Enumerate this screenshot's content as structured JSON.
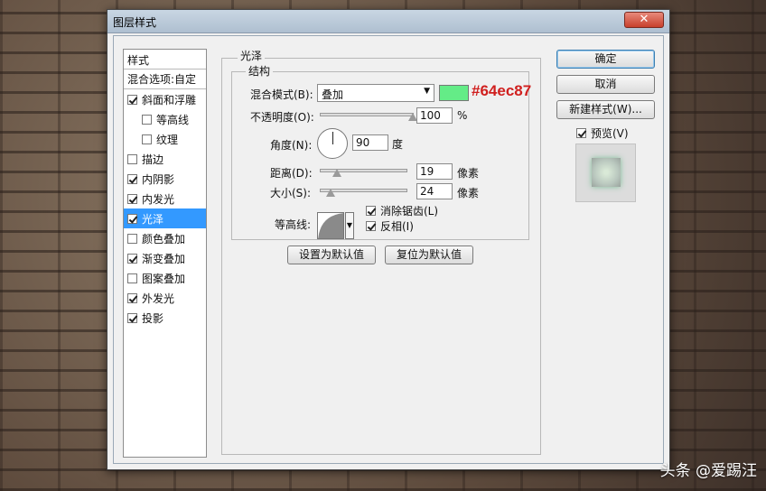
{
  "window": {
    "title": "图层样式",
    "close": "✕"
  },
  "style_list": {
    "header": "样式",
    "blend_options": "混合选项:自定",
    "items": [
      {
        "label": "斜面和浮雕",
        "checked": true,
        "sub": false,
        "selected": false
      },
      {
        "label": "等高线",
        "checked": false,
        "sub": true,
        "selected": false
      },
      {
        "label": "纹理",
        "checked": false,
        "sub": true,
        "selected": false
      },
      {
        "label": "描边",
        "checked": false,
        "sub": false,
        "selected": false
      },
      {
        "label": "内阴影",
        "checked": true,
        "sub": false,
        "selected": false
      },
      {
        "label": "内发光",
        "checked": true,
        "sub": false,
        "selected": false
      },
      {
        "label": "光泽",
        "checked": true,
        "sub": false,
        "selected": true
      },
      {
        "label": "颜色叠加",
        "checked": false,
        "sub": false,
        "selected": false
      },
      {
        "label": "渐变叠加",
        "checked": true,
        "sub": false,
        "selected": false
      },
      {
        "label": "图案叠加",
        "checked": false,
        "sub": false,
        "selected": false
      },
      {
        "label": "外发光",
        "checked": true,
        "sub": false,
        "selected": false
      },
      {
        "label": "投影",
        "checked": true,
        "sub": false,
        "selected": false
      }
    ]
  },
  "satin": {
    "section_title": "光泽",
    "group_title": "结构",
    "blend_mode": {
      "label": "混合模式(B):",
      "value": "叠加"
    },
    "color": {
      "hex": "#64ec87",
      "annotation": "#64ec87"
    },
    "opacity": {
      "label": "不透明度(O):",
      "value": "100",
      "unit": "%",
      "fraction": 1.0
    },
    "angle": {
      "label": "角度(N):",
      "value": "90",
      "unit": "度"
    },
    "distance": {
      "label": "距离(D):",
      "value": "19",
      "unit": "像素",
      "fraction": 0.19
    },
    "size": {
      "label": "大小(S):",
      "value": "24",
      "unit": "像素",
      "fraction": 0.12
    },
    "contour": {
      "label": "等高线:"
    },
    "anti_alias": {
      "label": "消除锯齿(L)",
      "checked": true
    },
    "invert": {
      "label": "反相(I)",
      "checked": true
    },
    "make_default": "设置为默认值",
    "reset_default": "复位为默认值"
  },
  "buttons": {
    "ok": "确定",
    "cancel": "取消",
    "new_style": "新建样式(W)...",
    "preview": {
      "label": "预览(V)",
      "checked": true
    }
  },
  "watermark": "头条 @爱踢汪"
}
